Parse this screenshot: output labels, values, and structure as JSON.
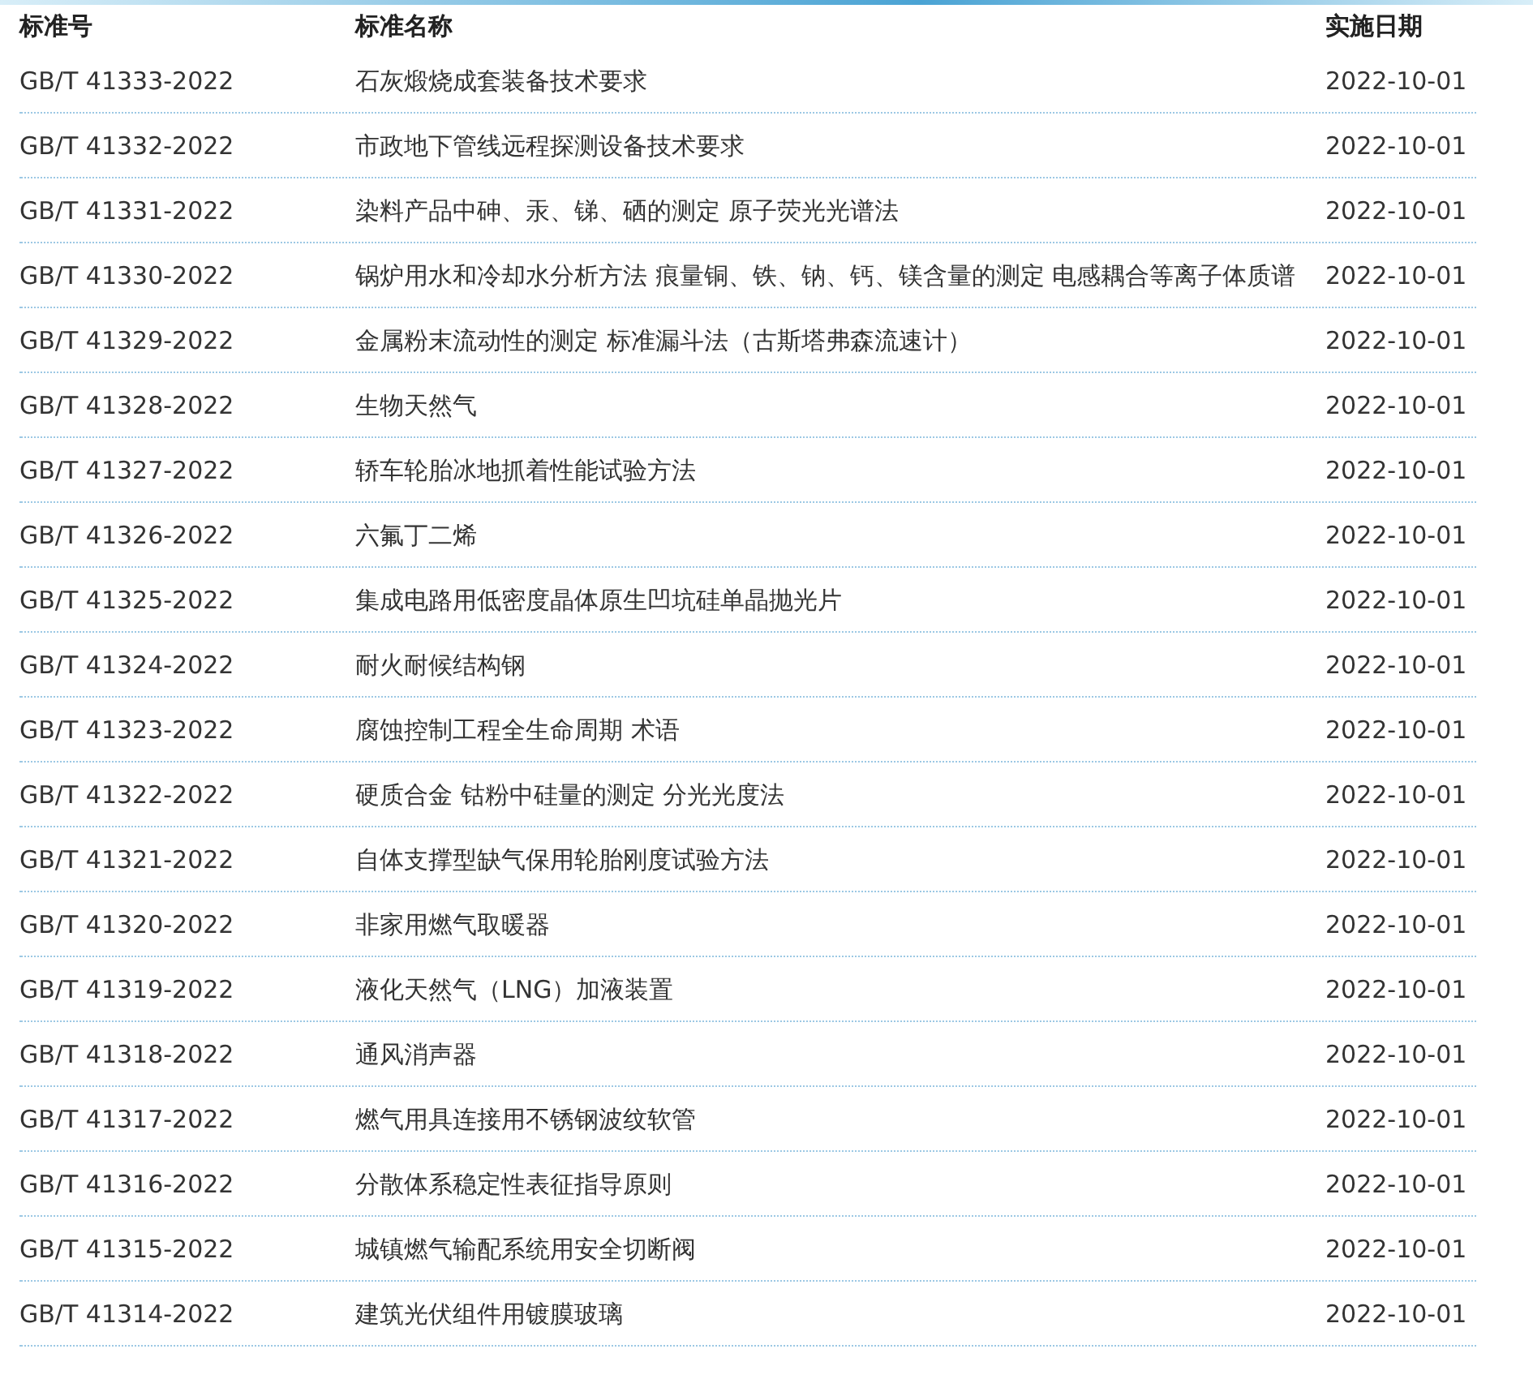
{
  "table": {
    "columns": [
      "标准号",
      "标准名称",
      "实施日期"
    ],
    "rows": [
      {
        "code": "GB/T 41333-2022",
        "name": "石灰煅烧成套装备技术要求",
        "date": "2022-10-01"
      },
      {
        "code": "GB/T 41332-2022",
        "name": "市政地下管线远程探测设备技术要求",
        "date": "2022-10-01"
      },
      {
        "code": "GB/T 41331-2022",
        "name": "染料产品中砷、汞、锑、硒的测定 原子荧光光谱法",
        "date": "2022-10-01"
      },
      {
        "code": "GB/T 41330-2022",
        "name": "锅炉用水和冷却水分析方法 痕量铜、铁、钠、钙、镁含量的测定 电感耦合等离子体质谱",
        "date": "2022-10-01"
      },
      {
        "code": "GB/T 41329-2022",
        "name": "金属粉末流动性的测定 标准漏斗法（古斯塔弗森流速计）",
        "date": "2022-10-01"
      },
      {
        "code": "GB/T 41328-2022",
        "name": "生物天然气",
        "date": "2022-10-01"
      },
      {
        "code": "GB/T 41327-2022",
        "name": "轿车轮胎冰地抓着性能试验方法",
        "date": "2022-10-01"
      },
      {
        "code": "GB/T 41326-2022",
        "name": "六氟丁二烯",
        "date": "2022-10-01"
      },
      {
        "code": "GB/T 41325-2022",
        "name": "集成电路用低密度晶体原生凹坑硅单晶抛光片",
        "date": "2022-10-01"
      },
      {
        "code": "GB/T 41324-2022",
        "name": "耐火耐候结构钢",
        "date": "2022-10-01"
      },
      {
        "code": "GB/T 41323-2022",
        "name": "腐蚀控制工程全生命周期 术语",
        "date": "2022-10-01"
      },
      {
        "code": "GB/T 41322-2022",
        "name": "硬质合金 钴粉中硅量的测定 分光光度法",
        "date": "2022-10-01"
      },
      {
        "code": "GB/T 41321-2022",
        "name": "自体支撑型缺气保用轮胎刚度试验方法",
        "date": "2022-10-01"
      },
      {
        "code": "GB/T 41320-2022",
        "name": "非家用燃气取暖器",
        "date": "2022-10-01"
      },
      {
        "code": "GB/T 41319-2022",
        "name": "液化天然气（LNG）加液装置",
        "date": "2022-10-01"
      },
      {
        "code": "GB/T 41318-2022",
        "name": "通风消声器",
        "date": "2022-10-01"
      },
      {
        "code": "GB/T 41317-2022",
        "name": "燃气用具连接用不锈钢波纹软管",
        "date": "2022-10-01"
      },
      {
        "code": "GB/T 41316-2022",
        "name": "分散体系稳定性表征指导原则",
        "date": "2022-10-01"
      },
      {
        "code": "GB/T 41315-2022",
        "name": "城镇燃气输配系统用安全切断阀",
        "date": "2022-10-01"
      },
      {
        "code": "GB/T 41314-2022",
        "name": "建筑光伏组件用镀膜玻璃",
        "date": "2022-10-01"
      }
    ]
  }
}
